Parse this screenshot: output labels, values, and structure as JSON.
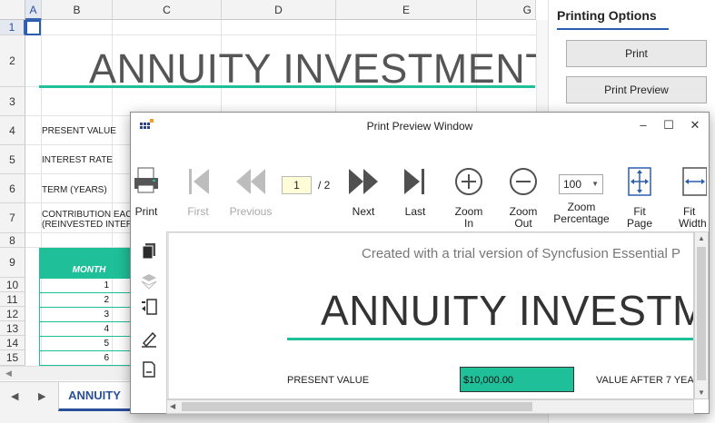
{
  "sheet": {
    "columns": [
      "A",
      "B",
      "C",
      "D",
      "E",
      "G"
    ],
    "rows": [
      "1",
      "2",
      "3",
      "4",
      "5",
      "6",
      "7",
      "8",
      "9",
      "10",
      "11",
      "12",
      "13",
      "14",
      "15"
    ],
    "title": "ANNUITY INVESTMENT",
    "labels": {
      "present_value": "PRESENT VALUE",
      "interest_rate": "INTEREST RATE",
      "term": "TERM (YEARS)",
      "contribution_1": "CONTRIBUTION EAC",
      "contribution_2": "(REINVESTED INTER"
    },
    "table_header": "MONTH",
    "months": [
      "1",
      "2",
      "3",
      "4",
      "5",
      "6"
    ],
    "tab_label": "ANNUITY"
  },
  "panel": {
    "title": "Printing Options",
    "print_button": "Print",
    "print_preview_button": "Print Preview"
  },
  "preview_window": {
    "title": "Print Preview Window",
    "toolbar": {
      "print": "Print",
      "first": "First",
      "previous": "Previous",
      "page_current": "1",
      "page_total": "/ 2",
      "next": "Next",
      "last": "Last",
      "zoom_in_1": "Zoom",
      "zoom_in_2": "In",
      "zoom_out_1": "Zoom",
      "zoom_out_2": "Out",
      "zoom_value": "100",
      "zoom_pct_1": "Zoom",
      "zoom_pct_2": "Percentage",
      "fit_page_1": "Fit",
      "fit_page_2": "Page",
      "fit_width_1": "Fit",
      "fit_width_2": "Width"
    },
    "preview": {
      "trial_text": "Created with a trial version of Syncfusion Essential P",
      "title": "ANNUITY INVESTM",
      "present_value_label": "PRESENT VALUE",
      "present_value": "$10,000.00",
      "value_after": "VALUE AFTER 7 YEA"
    }
  },
  "colors": {
    "accent_green": "#1fbf99",
    "accent_blue": "#2a5db0"
  }
}
